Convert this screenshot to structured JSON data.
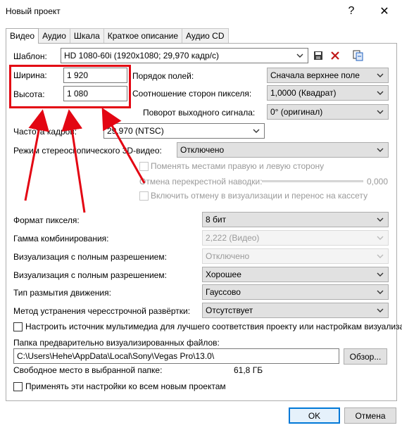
{
  "window": {
    "title": "Новый проект",
    "help_label": "?",
    "close_label": "✕"
  },
  "tabs": [
    {
      "label": "Видео",
      "active": true
    },
    {
      "label": "Аудио"
    },
    {
      "label": "Шкала"
    },
    {
      "label": "Краткое описание"
    },
    {
      "label": "Аудио CD"
    }
  ],
  "template": {
    "label": "Шаблон:",
    "value": "HD 1080-60i (1920x1080; 29,970 кадр/с)"
  },
  "width": {
    "label": "Ширина:",
    "value": "1 920"
  },
  "height": {
    "label": "Высота:",
    "value": "1 080"
  },
  "field_order": {
    "label": "Порядок полей:",
    "value": "Сначала верхнее поле"
  },
  "pixel_aspect": {
    "label": "Соотношение сторон пикселя:",
    "value": "1,0000 (Квадрат)"
  },
  "rotation": {
    "label": "Поворот выходного сигнала:",
    "value": "0° (оригинал)"
  },
  "frame_rate": {
    "label": "Частота кадров:",
    "value": "29,970 (NTSC)"
  },
  "stereo3d": {
    "label": "Режим стереоскопического 3D-видео:",
    "value": "Отключено"
  },
  "swap_lr": {
    "label": "Поменять местами правую и левую сторону"
  },
  "crossover": {
    "label": "Отмена перекрестной наводки:",
    "value": "0,000",
    "level": 0
  },
  "enable_cancel": {
    "label": "Включить отмену в визуализации и перенос на кассету"
  },
  "pixel_format": {
    "label": "Формат пикселя:",
    "value": "8 бит"
  },
  "gamma": {
    "label": "Гамма комбинирования:",
    "value": "2,222 (Видео)"
  },
  "full_res_1": {
    "label": "Визуализация с полным разрешением:",
    "value": "Отключено"
  },
  "full_res_2": {
    "label": "Визуализация с полным разрешением:",
    "value": "Хорошее"
  },
  "motion_blur": {
    "label": "Тип размытия движения:",
    "value": "Гауссово"
  },
  "deinterlace": {
    "label": "Метод устранения чересстрочной развёртки:",
    "value": "Отсутствует"
  },
  "adjust_media": {
    "label": "Настроить источник мультимедиа для лучшего соответствия проекту или настройкам визуализации"
  },
  "prerender": {
    "label": "Папка предварительно визуализированных файлов:",
    "value": "C:\\Users\\Hehe\\AppData\\Local\\Sony\\Vegas Pro\\13.0\\",
    "browse_label": "Обзор..."
  },
  "free_space": {
    "label": "Свободное место в выбранной папке:",
    "value": "61,8 ГБ"
  },
  "apply_all": {
    "label": "Применять эти настройки ко всем новым проектам"
  },
  "footer": {
    "ok_label": "OK",
    "cancel_label": "Отмена"
  },
  "colors": {
    "annotation_red": "#e30613",
    "accent": "#0078d7"
  }
}
